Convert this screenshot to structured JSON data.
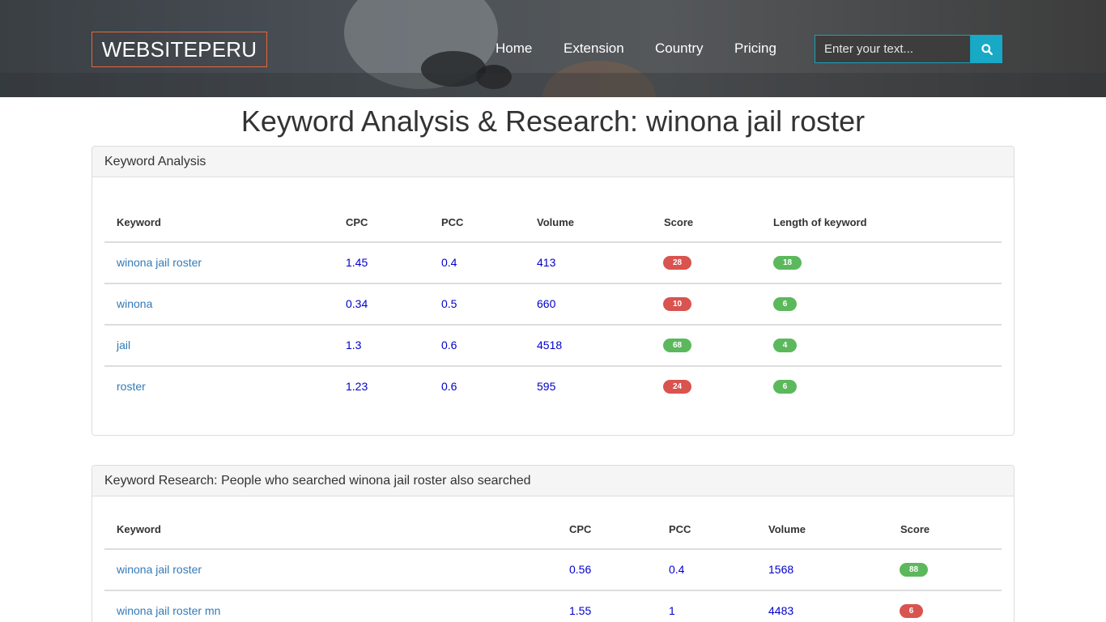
{
  "header": {
    "logo": "WEBSITEPERU",
    "nav": [
      "Home",
      "Extension",
      "Country",
      "Pricing"
    ],
    "search_placeholder": "Enter your text..."
  },
  "page_title": "Keyword Analysis & Research: winona jail roster",
  "analysis": {
    "heading": "Keyword Analysis",
    "columns": [
      "Keyword",
      "CPC",
      "PCC",
      "Volume",
      "Score",
      "Length of keyword"
    ],
    "rows": [
      {
        "keyword": "winona jail roster",
        "cpc": "1.45",
        "pcc": "0.4",
        "volume": "413",
        "score": "28",
        "length": "18"
      },
      {
        "keyword": "winona",
        "cpc": "0.34",
        "pcc": "0.5",
        "volume": "660",
        "score": "10",
        "length": "6"
      },
      {
        "keyword": "jail",
        "cpc": "1.3",
        "pcc": "0.6",
        "volume": "4518",
        "score": "68",
        "length": "4"
      },
      {
        "keyword": "roster",
        "cpc": "1.23",
        "pcc": "0.6",
        "volume": "595",
        "score": "24",
        "length": "6"
      }
    ]
  },
  "research": {
    "heading": "Keyword Research: People who searched winona jail roster also searched",
    "columns": [
      "Keyword",
      "CPC",
      "PCC",
      "Volume",
      "Score"
    ],
    "rows": [
      {
        "keyword": "winona jail roster",
        "cpc": "0.56",
        "pcc": "0.4",
        "volume": "1568",
        "score": "88"
      },
      {
        "keyword": "winona jail roster mn",
        "cpc": "1.55",
        "pcc": "1",
        "volume": "4483",
        "score": "6"
      }
    ]
  },
  "colors": {
    "accent": "#17a9c6",
    "logo_border": "#e8653a",
    "badge_red": "#d9534f",
    "badge_green": "#5cb85c",
    "link": "#337ab7",
    "number": "#0000cc"
  },
  "icons": {
    "search": "search-icon"
  }
}
